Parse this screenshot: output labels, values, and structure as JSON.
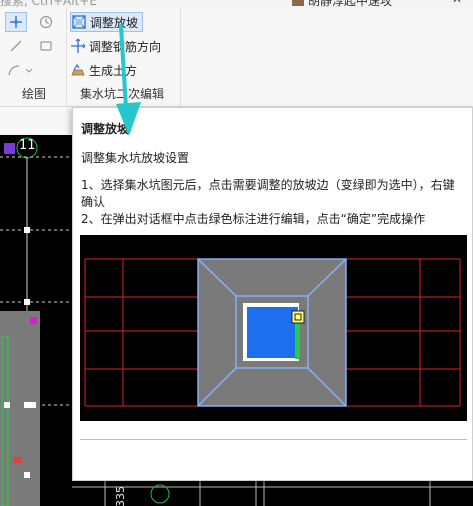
{
  "topbar": {
    "search_placeholder": "搜索, Ctrl+Alt+E",
    "user_name": "胡静淳起中速攻",
    "min_icon": "minimize-icon",
    "close_icon": "close-icon"
  },
  "ribbon": {
    "draw_group": {
      "label": "绘图",
      "tools": [
        "point-icon",
        "clock-icon",
        "line-icon",
        "rect-icon",
        "arc-icon"
      ]
    },
    "sump_group": {
      "label": "集水坑二次编辑",
      "commands": [
        {
          "label": "调整放坡",
          "icon": "slope-adjust-icon",
          "active": true
        },
        {
          "label": "调整钢筋方向",
          "icon": "rebar-direction-icon",
          "active": false
        },
        {
          "label": "生成土方",
          "icon": "earthwork-icon",
          "active": false
        }
      ]
    }
  },
  "canvas": {
    "axis_label": "11",
    "dim_text": "335"
  },
  "tooltip": {
    "title": "调整放坡",
    "subtitle": "调整集水坑放坡设置",
    "step1": "1、选择集水坑图元后，点击需要调整的放坡边（变绿即为选中），右键确认",
    "step2": "2、在弹出对话框中点击绿色标注进行编辑，点击“确定”完成操作"
  },
  "colors": {
    "accent_cyan": "#26c6cf",
    "grid_red": "#e02020",
    "slope_gray": "#7a7a7a",
    "pit_blue": "#1e6ef0",
    "select_green": "#20d040",
    "outline_blue": "#8ab4ff"
  }
}
